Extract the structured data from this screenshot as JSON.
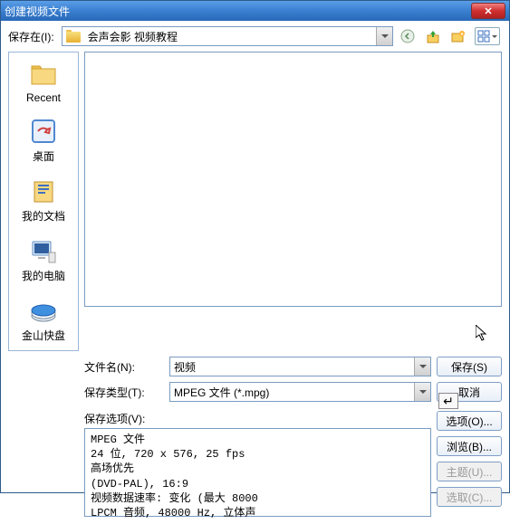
{
  "title": "创建视频文件",
  "toolbar": {
    "save_in_label": "保存在(I):",
    "location": "会声会影  视频教程"
  },
  "places": [
    {
      "label": "Recent"
    },
    {
      "label": "桌面"
    },
    {
      "label": "我的文档"
    },
    {
      "label": "我的电脑"
    },
    {
      "label": "金山快盘"
    }
  ],
  "filename_label": "文件名(N):",
  "filename_value": "视频",
  "filetype_label": "保存类型(T):",
  "filetype_value": "MPEG 文件 (*.mpg)",
  "save_btn": "保存(S)",
  "cancel_btn": "取消",
  "options_label": "保存选项(V):",
  "details": "MPEG 文件\n24 位, 720 x 576, 25 fps\n高场优先\n(DVD-PAL),  16:9\n视频数据速率: 变化 (最大  8000\nLPCM 音频, 48000 Hz, 立体声",
  "side_btns": {
    "options": "选项(O)...",
    "browse": "浏览(B)...",
    "subject": "主题(U)...",
    "select": "选取(C)..."
  }
}
